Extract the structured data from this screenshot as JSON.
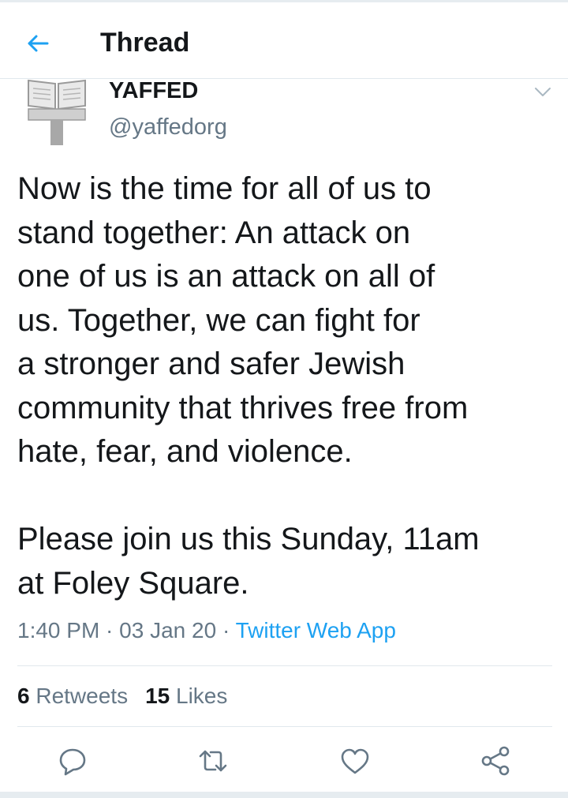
{
  "header": {
    "title": "Thread",
    "back_icon": "arrow-left-icon",
    "accent": "#1da1f2"
  },
  "tweet": {
    "author_name": "YAFFED",
    "author_handle": "@yaffedorg",
    "avatar_icon": "book-on-post-icon",
    "text": "Now is the time for all of us to\nstand together: An attack on\none of us is an attack on all of\nus. Together, we can fight for\na stronger and safer Jewish\ncommunity that thrives free from\nhate, fear, and violence.\n\nPlease join us this Sunday, 11am\nat Foley Square.",
    "time": "1:40 PM",
    "date": "03 Jan 20",
    "separator": " · ",
    "source": "Twitter Web App"
  },
  "stats": {
    "retweets_count": "6",
    "retweets_label": "Retweets",
    "likes_count": "15",
    "likes_label": "Likes"
  },
  "actions": [
    "reply-icon",
    "retweet-icon",
    "like-icon",
    "share-icon"
  ]
}
